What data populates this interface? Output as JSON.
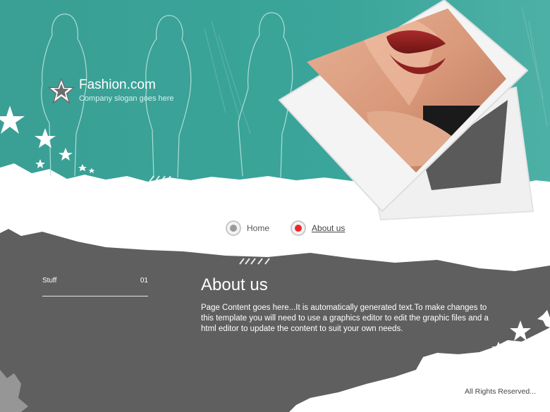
{
  "header": {
    "site_name": "Fashion.com",
    "slogan": "Company slogan goes here"
  },
  "nav": {
    "items": [
      {
        "label": "Home",
        "active": false
      },
      {
        "label": "About us",
        "active": true
      }
    ]
  },
  "sidebar": {
    "items": [
      {
        "label": "Stuff",
        "number": "01"
      }
    ]
  },
  "main": {
    "title": "About us",
    "body": "Page Content goes here...It is automatically generated text.To make changes to this template you will need to use a graphics editor to edit the graphic files and a html editor to update the content to suit your own needs."
  },
  "footer": {
    "text": "All Rights Reserved..."
  },
  "colors": {
    "teal": "#3aa399",
    "gray": "#5f5f5f",
    "active_dot": "#e8282a"
  }
}
